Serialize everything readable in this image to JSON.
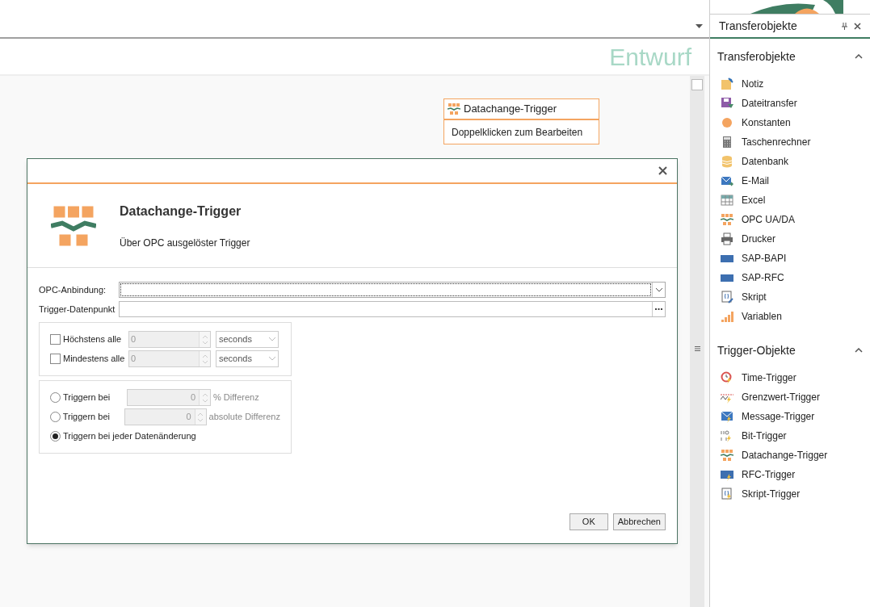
{
  "editor": {
    "status": "Entwurf"
  },
  "node": {
    "title": "Datachange-Trigger",
    "hint": "Doppelklicken zum Bearbeiten"
  },
  "dialog": {
    "title": "Datachange-Trigger",
    "subtitle": "Über OPC ausgelöster Trigger",
    "opc_binding": {
      "label": "OPC-Anbindung:"
    },
    "trigger_point": {
      "label": "Trigger-Datenpunkt"
    },
    "intervals": [
      {
        "label": "Höchstens alle",
        "checked": false,
        "value": "0",
        "unit": "seconds"
      },
      {
        "label": "Mindestens alle",
        "checked": false,
        "value": "0",
        "unit": "seconds"
      }
    ],
    "modes": [
      {
        "label": "Triggern bei",
        "selected": false,
        "value": "0",
        "suffix": "% Differenz"
      },
      {
        "label": "Triggern bei",
        "selected": false,
        "value": "0",
        "suffix": "absolute Differenz"
      },
      {
        "label": "Triggern bei jeder Datenänderung",
        "selected": true
      }
    ],
    "buttons": [
      "OK",
      "Abbrechen"
    ]
  },
  "panel": {
    "title": "Transferobjekte",
    "sections": [
      {
        "title": "Transferobjekte",
        "expanded": true,
        "items": [
          "Notiz",
          "Dateitransfer",
          "Konstanten",
          "Taschenrechner",
          "Datenbank",
          "E-Mail",
          "Excel",
          "OPC UA/DA",
          "Drucker",
          "SAP-BAPI",
          "SAP-RFC",
          "Skript",
          "Variablen"
        ]
      },
      {
        "title": "Trigger-Objekte",
        "expanded": true,
        "items": [
          "Time-Trigger",
          "Grenzwert-Trigger",
          "Message-Trigger",
          "Bit-Trigger",
          "Datachange-Trigger",
          "RFC-Trigger",
          "Skript-Trigger"
        ]
      }
    ]
  }
}
